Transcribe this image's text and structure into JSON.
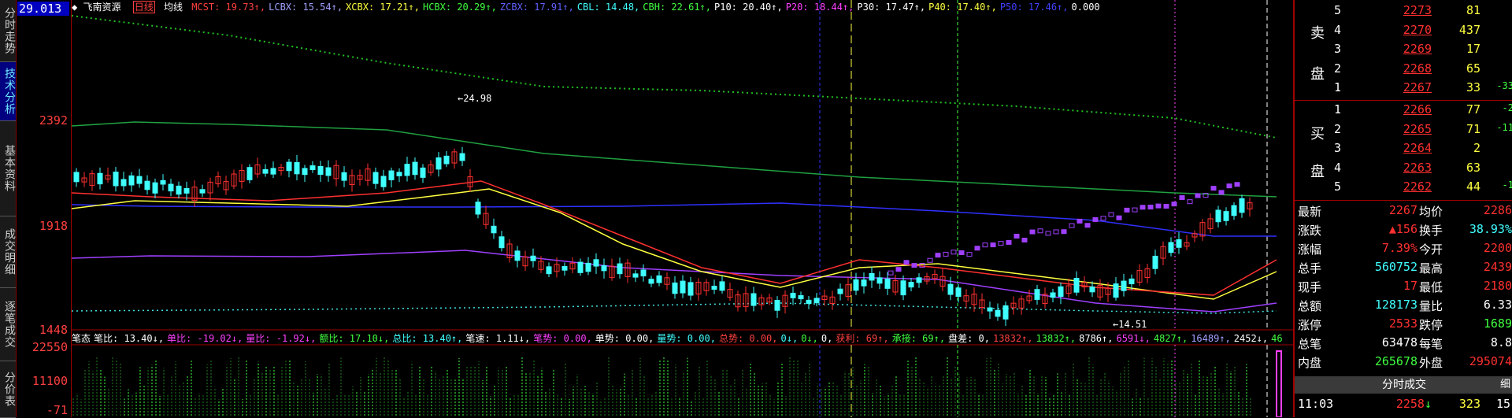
{
  "left_tabs": [
    {
      "label": "分时走势",
      "active": false
    },
    {
      "label": "技术分析",
      "active": true
    },
    {
      "label": "基本资料",
      "active": false
    },
    {
      "label": "成交明细",
      "active": false
    },
    {
      "label": "逐笔成交",
      "active": false
    },
    {
      "label": "分价表",
      "active": false
    }
  ],
  "price_axis": {
    "top_value": "29.013",
    "labels": [
      "2392",
      "1918",
      "1448"
    ],
    "volume_labels": [
      "22550",
      "11100",
      "-71"
    ]
  },
  "header": {
    "stock_name": "飞南资源",
    "period": "日线",
    "ma_mode": "均线",
    "indicators": [
      {
        "text": "MCST: 19.73↑,",
        "color": "#ff4040"
      },
      {
        "text": "LCBX: 15.54↑,",
        "color": "#a0a0ff"
      },
      {
        "text": "XCBX: 17.21↑,",
        "color": "#ffff40"
      },
      {
        "text": "HCBX: 20.29↑,",
        "color": "#40ff40"
      },
      {
        "text": "ZCBX: 17.91↑,",
        "color": "#6060ff"
      },
      {
        "text": "CBL: 14.48,",
        "color": "#40ffff"
      },
      {
        "text": "CBH: 22.61↑,",
        "color": "#40ff40"
      },
      {
        "text": "P10: 20.40↑,",
        "color": "#ffffff"
      },
      {
        "text": "P20: 18.44↑,",
        "color": "#ff40ff"
      },
      {
        "text": "P30: 17.47↑,",
        "color": "#ffffff"
      },
      {
        "text": "P40: 17.40↑,",
        "color": "#ffff40"
      },
      {
        "text": "P50: 17.46↑,",
        "color": "#4040ff"
      },
      {
        "text": "0.000",
        "color": "#ffffff"
      }
    ]
  },
  "annotations": {
    "high": "24.98",
    "low": "14.51"
  },
  "sub_header": {
    "items": [
      {
        "text": "笔态",
        "color": "#ffffff"
      },
      {
        "text": "笔比: 13.40↓,",
        "color": "#ffffff"
      },
      {
        "text": "单比: -19.02↓,",
        "color": "#ff40ff"
      },
      {
        "text": "量比: -1.92↓,",
        "color": "#ff40ff"
      },
      {
        "text": "额比: 17.10↓,",
        "color": "#40ff40"
      },
      {
        "text": "总比: 13.40↑,",
        "color": "#40ffff"
      },
      {
        "text": "笔速: 1.11↓,",
        "color": "#ffffff"
      },
      {
        "text": "笔势: 0.00,",
        "color": "#ff40ff"
      },
      {
        "text": "单势: 0.00,",
        "color": "#ffffff"
      },
      {
        "text": "量势: 0.00,",
        "color": "#40ffff"
      },
      {
        "text": "总势: 0.00,",
        "color": "#ff4040"
      },
      {
        "text": "0↓,",
        "color": "#40ffff"
      },
      {
        "text": "0↓,",
        "color": "#40ff40"
      },
      {
        "text": "0,",
        "color": "#ffffff"
      },
      {
        "text": "获利: 69↑,",
        "color": "#ff4040"
      },
      {
        "text": "承接: 69↑,",
        "color": "#40ff40"
      },
      {
        "text": "盘差: 0,",
        "color": "#ffffff"
      },
      {
        "text": "13832↑,",
        "color": "#ff4040"
      },
      {
        "text": "13832↑,",
        "color": "#40ff40"
      },
      {
        "text": "8786↑,",
        "color": "#ffffff"
      },
      {
        "text": "6591↓,",
        "color": "#ff40ff"
      },
      {
        "text": "4827↑,",
        "color": "#40ff40"
      },
      {
        "text": "16489↑,",
        "color": "#a0a0ff"
      },
      {
        "text": "2452↓,",
        "color": "#ffffff"
      },
      {
        "text": "46",
        "color": "#40ff40"
      }
    ]
  },
  "order_book": {
    "sell_label": [
      "卖",
      "盘"
    ],
    "buy_label": [
      "买",
      "盘"
    ],
    "sell": [
      {
        "level": "5",
        "price": "2273",
        "volume": "81",
        "change": ""
      },
      {
        "level": "4",
        "price": "2270",
        "volume": "437",
        "change": ""
      },
      {
        "level": "3",
        "price": "2269",
        "volume": "17",
        "change": ""
      },
      {
        "level": "2",
        "price": "2268",
        "volume": "65",
        "change": ""
      },
      {
        "level": "1",
        "price": "2267",
        "volume": "33",
        "change": "-33"
      }
    ],
    "buy": [
      {
        "level": "1",
        "price": "2266",
        "volume": "77",
        "change": "-2"
      },
      {
        "level": "2",
        "price": "2265",
        "volume": "71",
        "change": "-11"
      },
      {
        "level": "3",
        "price": "2264",
        "volume": "2",
        "change": ""
      },
      {
        "level": "4",
        "price": "2263",
        "volume": "63",
        "change": ""
      },
      {
        "level": "5",
        "price": "2262",
        "volume": "44",
        "change": "-1"
      }
    ]
  },
  "stats": [
    {
      "k1": "最新",
      "v1": "2267",
      "c1": "#ff3030",
      "k2": "均价",
      "v2": "2286",
      "c2": "#ff3030"
    },
    {
      "k1": "涨跌",
      "v1": "▲156",
      "c1": "#ff3030",
      "k2": "换手",
      "v2": "38.93%",
      "c2": "#40ffff"
    },
    {
      "k1": "涨幅",
      "v1": "7.39%",
      "c1": "#ff3030",
      "k2": "今开",
      "v2": "2200",
      "c2": "#ff3030"
    },
    {
      "k1": "总手",
      "v1": "560752",
      "c1": "#40ffff",
      "k2": "最高",
      "v2": "2439",
      "c2": "#ff3030"
    },
    {
      "k1": "现手",
      "v1": "17",
      "c1": "#ff3030",
      "k2": "最低",
      "v2": "2180",
      "c2": "#ff3030"
    },
    {
      "k1": "总额",
      "v1": "128173",
      "c1": "#40ffff",
      "k2": "量比",
      "v2": "6.33",
      "c2": "#ffffff"
    },
    {
      "k1": "涨停",
      "v1": "2533",
      "c1": "#ff3030",
      "k2": "跌停",
      "v2": "1689",
      "c2": "#40ff40"
    },
    {
      "k1": "总笔",
      "v1": "63478",
      "c1": "#ffffff",
      "k2": "每笔",
      "v2": "8.8",
      "c2": "#ffffff"
    },
    {
      "k1": "内盘",
      "v1": "265678",
      "c1": "#40ff40",
      "k2": "外盘",
      "v2": "295074",
      "c2": "#ff3030"
    }
  ],
  "tick": {
    "button_label": "分时成交",
    "detail_label": "细",
    "time": "11:03",
    "price": "2258",
    "arrow": "↓",
    "volume": "323",
    "count": "15"
  },
  "colors": {
    "up": "#ff3030",
    "down": "#40ffff",
    "axis": "#a00000"
  }
}
